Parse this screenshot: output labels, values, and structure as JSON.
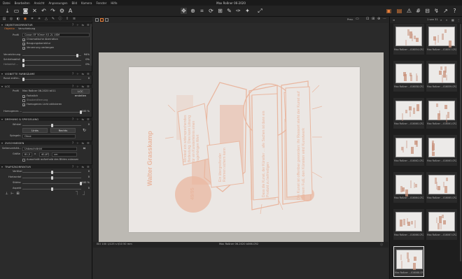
{
  "menubar": {
    "items": [
      "Datei",
      "Bearbeiten",
      "Ansicht",
      "Anpassungen",
      "Bild",
      "Kamera",
      "Fenster",
      "Hilfe"
    ],
    "window_title": "Max Roßner 06-2020"
  },
  "panel": {
    "sections": {
      "lens": "OBJEKTIVKORREKTUR",
      "vignette": "VIGNETTE FARBSÄUME",
      "lcc": "LCC",
      "rotate": "DREHUNG & SPIEGELUNG",
      "crop": "ZUSCHNEIDEN",
      "keystone": "TRAPEZKORREKTUR"
    },
    "lens": {
      "tab1": "Objektiv",
      "tab2": "Verschiebung",
      "profile_label": "Profil",
      "profile_value": "Canon EF 50mm f/1.2L USM",
      "chk1": "Chromatische Aberration",
      "chk2": "Beugungskorrektur",
      "chk3": "Verzerrung verbergen",
      "distortion_label": "Verzeichnung",
      "distortion_value": "94%",
      "sharpness_label": "Schärfeabfall",
      "sharpness_value": "0%",
      "light_label": "Hellabfall ...",
      "light_value": "0%"
    },
    "vignette": {
      "edge_label": "Rand entfer...",
      "edge_value": "0"
    },
    "lcc": {
      "profile_label": "Profil",
      "profile_value": "Max Roßner 06-2020 b011",
      "lcc_button": "LCC erstellen",
      "opt1": "Farbstich",
      "opt2": "Staubentfernung",
      "opt3": "Homogenes Licht aktivieren",
      "homogen_label": "Homogenes ...",
      "homogen_value": "100 %"
    },
    "rotate": {
      "angle_label": "Winkel",
      "angle_value": "0",
      "left_btn": "Links",
      "right_btn": "Rechts",
      "mirror_label": "Spiegeln",
      "mirror_value": "Ohne"
    },
    "crop": {
      "ratio_label": "Seitenverhält...",
      "ratio_value": "Unbeschränkt",
      "size_label": "Größe",
      "size_w": "81,5",
      "size_x": "x",
      "size_h": "40,67",
      "size_unit": "cm",
      "outside_label": "Ausschnitt außerhalb des Bildes zulassen"
    },
    "keystone": {
      "vertical_label": "Vertikal",
      "vertical_value": "0",
      "horizontal_label": "Horizontal",
      "horizontal_value": "0",
      "amount_label": "Stärke",
      "amount_value": "100 %",
      "aspect_label": "Aspekt",
      "aspect_value": "0"
    }
  },
  "viewer": {
    "zoom_label": "Prev.",
    "status_left": "ISO 100  1/125 s f/10  50 mm",
    "status_center": "Max Roßner 06-2020 b066.CR2",
    "poster": {
      "author": "Walter Grasskamp",
      "page": "49/95",
      "col1": "Die Kunst ist offenbar geworden: ihr Ressort steht der Kunst auf kleinem Fuß, den Künsten wird Kunstwerk",
      "col2": "Dass die Kunst, der Künstler ... alle Sachen ist dann ein Produkt zu befriedigen",
      "col3": "Ein übergreifender Rahmen sichern kann",
      "col4": "Mindest ein widersprechendes Bedeutung. Dies kann Lösung für ein Kunsterlebnis einen zugehörigen Wert"
    }
  },
  "browser": {
    "count": "1 von 31",
    "thumbs": [
      {
        "cap": "Max Roßner ...016054.CR2"
      },
      {
        "cap": "Max Roßner ...016057.CR2"
      },
      {
        "cap": "Max Roßner ...016058.CR2"
      },
      {
        "cap": "Max Roßner ...016059.CR2"
      },
      {
        "cap": "Max Roßner ...016060.CR2"
      },
      {
        "cap": "Max Roßner ...016061.CR2"
      },
      {
        "cap": "Max Roßner ...016062.CR2"
      },
      {
        "cap": "Max Roßner ...016063.CR2"
      },
      {
        "cap": "Max Roßner ...016064.CR2"
      },
      {
        "cap": "Max Roßner ...016065.CR2"
      },
      {
        "cap": "Max Roßner ...016066.CR2"
      },
      {
        "cap": "Max Roßner ...016067.CR2"
      },
      {
        "cap": "Max Roßner ...016068.CR2"
      }
    ]
  },
  "colors": {
    "accent": "#e8803a",
    "print": "#e9b7a0"
  }
}
